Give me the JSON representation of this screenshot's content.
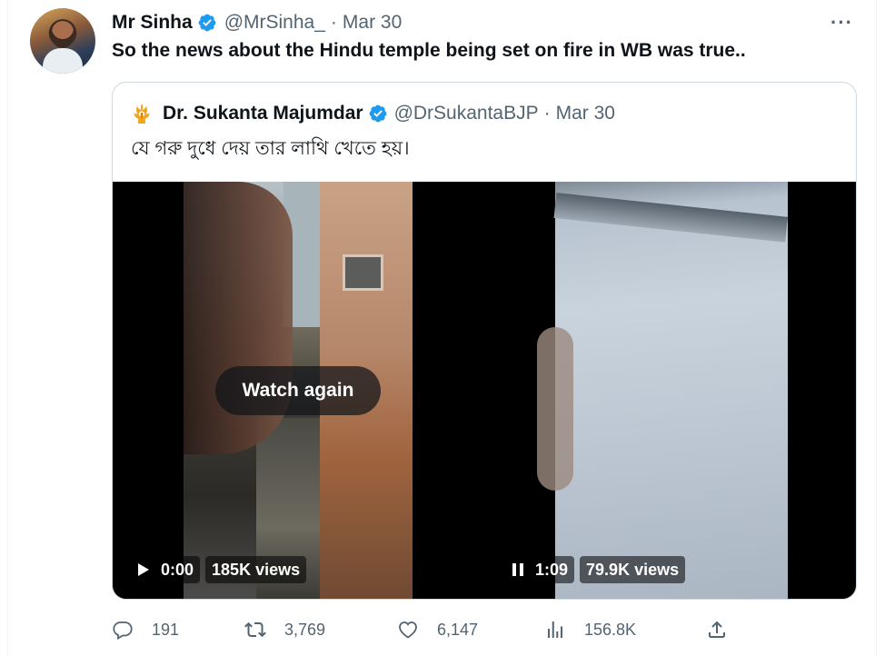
{
  "tweet": {
    "author_name": "Mr Sinha",
    "handle": "@MrSinha_",
    "separator": "·",
    "date": "Mar 30",
    "text": "So the news about the Hindu temple being set on fire in WB was true..",
    "more_label": "···"
  },
  "quoted_tweet": {
    "author_name": "Dr. Sukanta Majumdar",
    "handle": "@DrSukantaBJP",
    "separator": "·",
    "date": "Mar 30",
    "text": "যে গরু দুধে দেয় তার লাথি খেতে হয়।"
  },
  "media": {
    "video1": {
      "overlay_label": "Watch again",
      "time": "0:00",
      "views": "185K views",
      "state": "play-icon"
    },
    "video2": {
      "time": "1:09",
      "views": "79.9K views",
      "state": "pause-icon"
    }
  },
  "actions": {
    "replies": "191",
    "retweets": "3,769",
    "likes": "6,147",
    "views": "156.8K"
  },
  "colors": {
    "text_primary": "#0f1419",
    "text_secondary": "#536471",
    "verified_blue": "#1d9bf0",
    "border": "#cfd9de"
  }
}
